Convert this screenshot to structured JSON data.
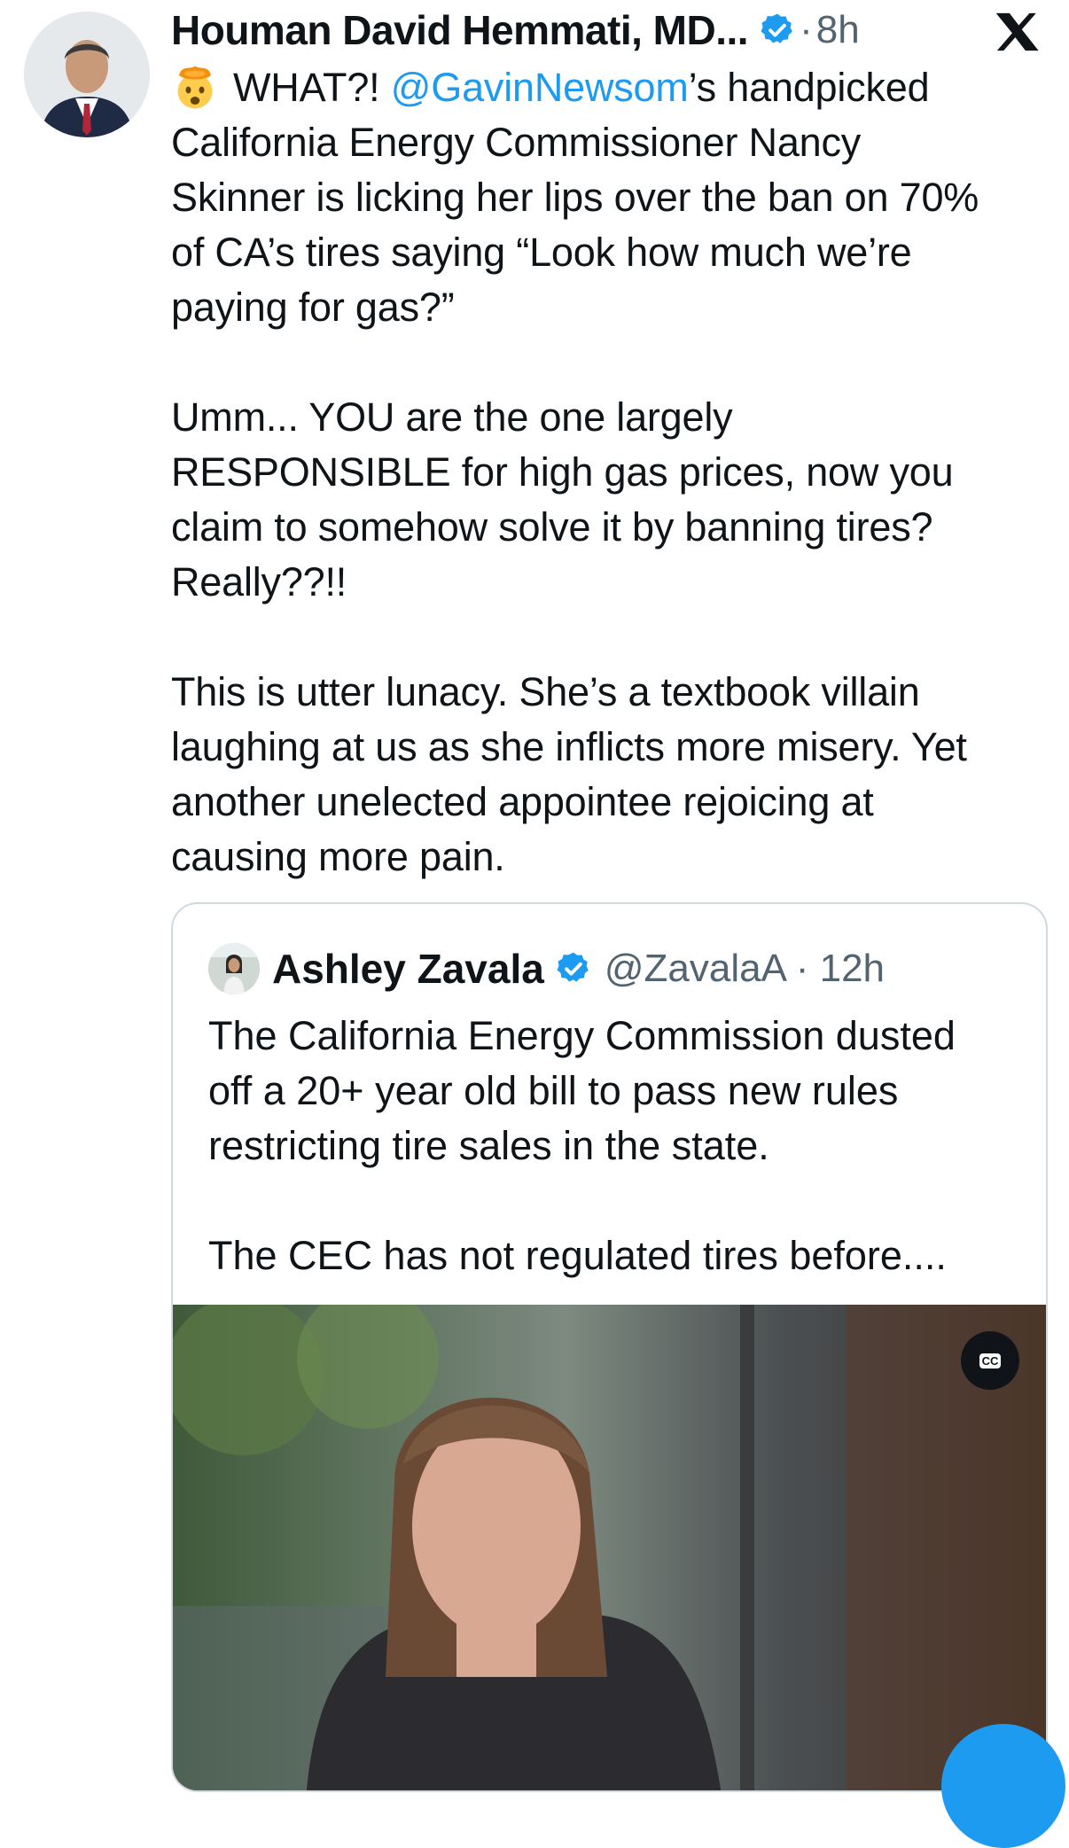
{
  "tweet": {
    "author_name": "Houman David Hemmati, MD...",
    "separator": "·",
    "time": "8h",
    "line1_prefix": "WHAT?!",
    "mention": "@GavinNewsom",
    "line1_suffix": "’s handpicked",
    "paragraph1_rest": "California Energy Commissioner Nancy\nSkinner is licking her lips over the ban on 70%\nof CA’s tires saying “Look how much we’re\npaying for gas?”",
    "paragraph2": "Umm... YOU are the one largely\nRESPONSIBLE for high gas prices, now you\nclaim to somehow solve it by banning tires?\nReally??!!",
    "paragraph3": "This is utter lunacy. She’s a textbook villain\nlaughing at us as she inflicts more misery. Yet\nanother unelected appointee rejoicing at\ncausing more pain."
  },
  "quote": {
    "author_name": "Ashley Zavala",
    "handle_time": "@ZavalaA · 12h",
    "paragraph1": "The California Energy Commission dusted\noff a 20+ year old bill to pass new rules\nrestricting tire sales in the state.",
    "paragraph2": "The CEC has not regulated tires before....",
    "video_cc_label": "CC"
  },
  "icons": {
    "author_avatar": "avatar-photo",
    "verified": "verified-badge-icon",
    "brand": "x-logo-icon",
    "emoji": "exploding-head-emoji",
    "captions": "closed-captions-icon",
    "mute": "mute-icon"
  },
  "colors": {
    "accent": "#1d9bf0",
    "text": "#0f1419",
    "muted": "#536471",
    "border": "#cfd9de"
  }
}
